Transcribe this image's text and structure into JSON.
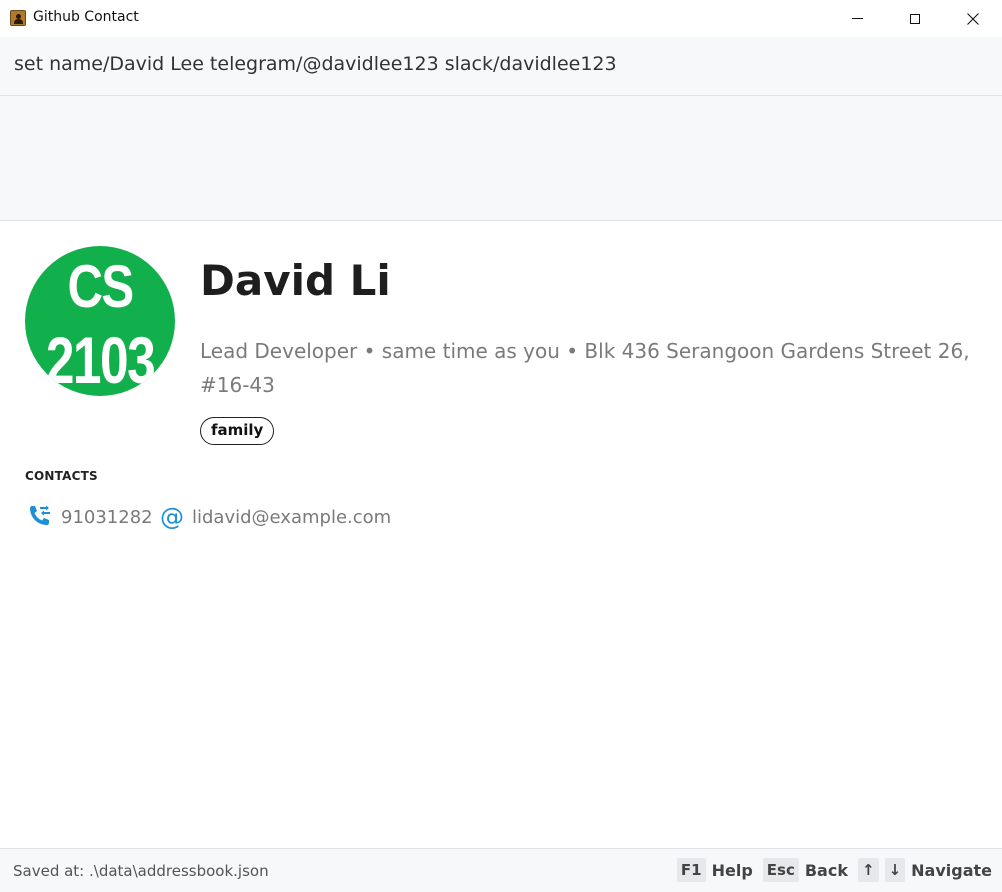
{
  "window": {
    "title": "Github Contact",
    "icon": "contact-book-icon",
    "controls": [
      "minimize-icon",
      "maximize-icon",
      "close-icon"
    ]
  },
  "command": {
    "value": "set name/David Lee telegram/@davidlee123 slack/davidlee123"
  },
  "result": {
    "text": ""
  },
  "profile": {
    "avatar_line1": "CS",
    "avatar_line2": "2103",
    "avatar_color": "#12b04c",
    "name": "David Li",
    "details": "Lead Developer • same time as you • Blk 436 Serangoon Gardens Street 26, #16-43",
    "tags": [
      "family"
    ]
  },
  "contacts": {
    "heading": "CONTACTS",
    "phone": {
      "icon": "phone-transfer-icon",
      "value": "91031282"
    },
    "email": {
      "icon": "at-sign-icon",
      "glyph": "@",
      "value": "lidavid@example.com"
    },
    "icon_color": "#1c8fd6"
  },
  "status_bar": {
    "save_location": "Saved at: .\\data\\addressbook.json",
    "shortcuts": [
      {
        "keys": [
          "F1"
        ],
        "label": "Help"
      },
      {
        "keys": [
          "Esc"
        ],
        "label": "Back"
      },
      {
        "keys": [
          "↑",
          "↓"
        ],
        "label": "Navigate"
      }
    ]
  }
}
